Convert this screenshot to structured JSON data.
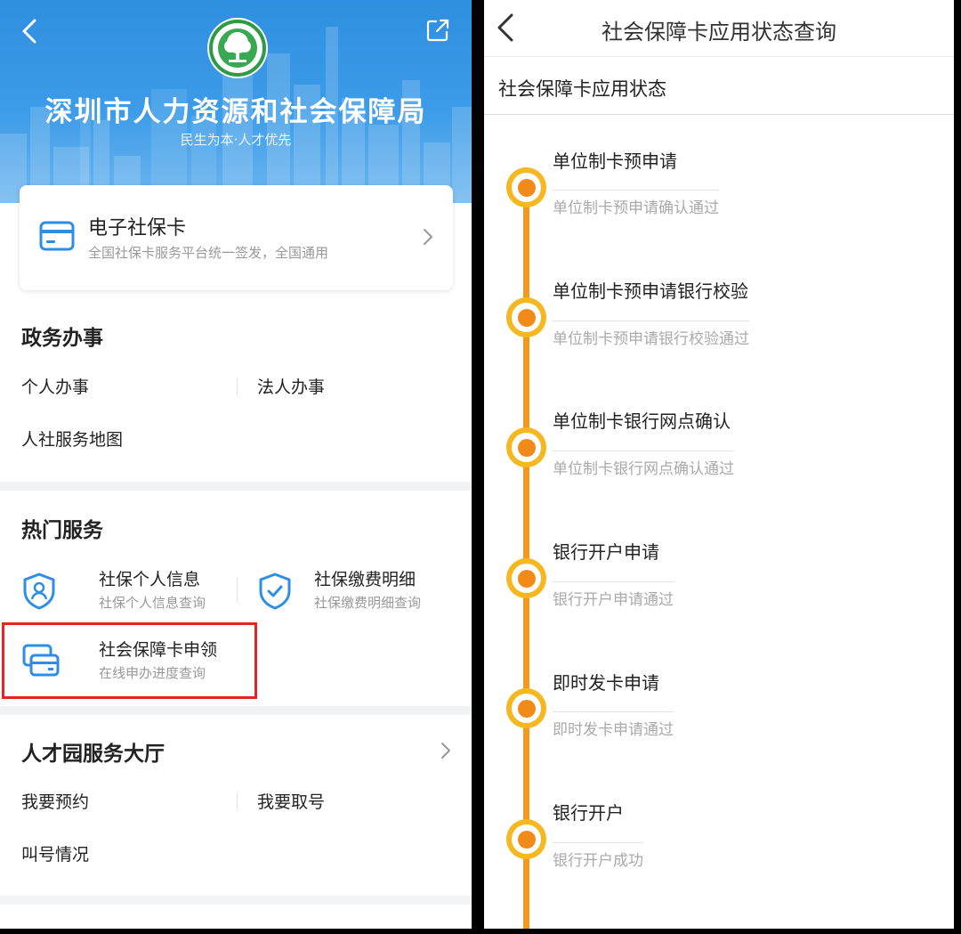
{
  "left": {
    "banner": {
      "title": "深圳市人力资源和社会保障局",
      "subtitle": "民生为本·人才优先",
      "logo_icon": "tree-emblem-icon",
      "back_icon": "chevron-left-icon",
      "share_icon": "share-external-icon"
    },
    "ecard": {
      "title": "电子社保卡",
      "subtitle": "全国社保卡服务平台统一签发，全国通用",
      "icon": "card-icon"
    },
    "gov": {
      "title": "政务办事",
      "items": [
        "个人办事",
        "法人办事",
        "人社服务地图"
      ]
    },
    "hot": {
      "title": "热门服务",
      "items": [
        {
          "title": "社保个人信息",
          "subtitle": "社保个人信息查询",
          "icon": "shield-user-icon"
        },
        {
          "title": "社保缴费明细",
          "subtitle": "社保缴费明细查询",
          "icon": "shield-check-icon"
        },
        {
          "title": "社会保障卡申领",
          "subtitle": "在线申办进度查询",
          "icon": "card-stack-icon"
        }
      ]
    },
    "talent": {
      "title": "人才园服务大厅",
      "items": [
        "我要预约",
        "我要取号",
        "叫号情况"
      ]
    }
  },
  "right": {
    "title": "社会保障卡应用状态查询",
    "section": "社会保障卡应用状态",
    "steps": [
      {
        "label": "单位制卡预申请",
        "desc": "单位制卡预申请确认通过"
      },
      {
        "label": "单位制卡预申请银行校验",
        "desc": "单位制卡预申请银行校验通过"
      },
      {
        "label": "单位制卡银行网点确认",
        "desc": "单位制卡银行网点确认通过"
      },
      {
        "label": "银行开户申请",
        "desc": "银行开户申请通过"
      },
      {
        "label": "即时发卡申请",
        "desc": "即时发卡申请通过"
      },
      {
        "label": "银行开户",
        "desc": "银行开户成功"
      }
    ],
    "accent": "#f39a1e"
  }
}
